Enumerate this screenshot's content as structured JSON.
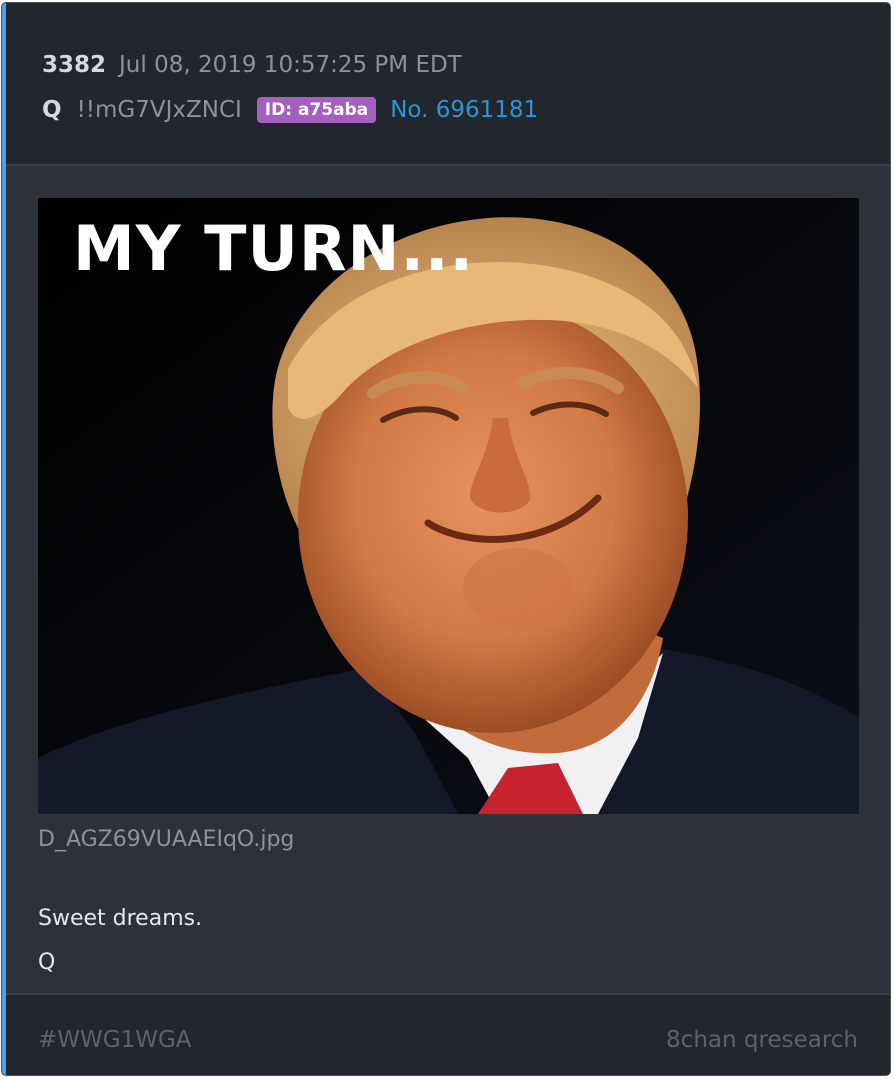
{
  "post": {
    "number": "3382",
    "timestamp": "Jul 08, 2019 10:57:25 PM EDT",
    "author": "Q",
    "tripcode": "!!mG7VJxZNCI",
    "id_badge": "ID: a75aba",
    "post_no": "No. 6961181"
  },
  "attachment": {
    "overlay_text": "MY TURN...",
    "filename": "D_AGZ69VUAAEIqO.jpg"
  },
  "message": {
    "lines": [
      "Sweet dreams.",
      "Q"
    ]
  },
  "footer": {
    "hashtag": "#WWG1WGA",
    "source": "8chan qresearch"
  },
  "colors": {
    "card_bg": "#2c313a",
    "header_bg": "#22262d",
    "accent": "#4aa3ea",
    "id_badge": "#a55fc0",
    "post_link": "#2f94d6"
  }
}
